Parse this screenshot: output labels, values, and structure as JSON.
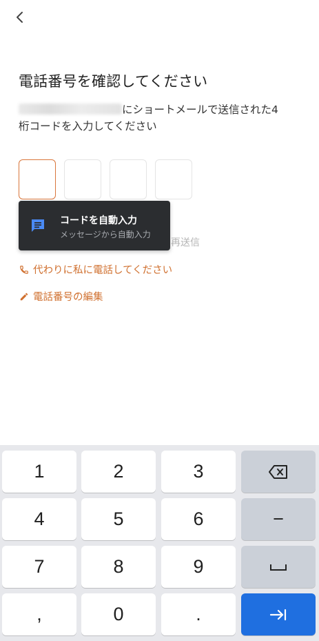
{
  "header": {
    "back_icon": "chevron-left-icon"
  },
  "title": "電話番号を確認してください",
  "description": {
    "after_number": "にショートメールで送信された4",
    "line2": "桁コードを入力してください"
  },
  "code_inputs": [
    "",
    "",
    "",
    ""
  ],
  "resend_text": "再送信",
  "autofill_popup": {
    "title": "コードを自動入力",
    "subtitle": "メッセージから自動入力",
    "icon": "message-icon",
    "icon_color": "#4a8af4"
  },
  "links": {
    "call_me": "代わりに私に電話してください",
    "edit_number": "電話番号の編集",
    "color": "#d0702f"
  },
  "keyboard": {
    "rows": [
      [
        "1",
        "2",
        "3",
        "backspace"
      ],
      [
        "4",
        "5",
        "6",
        "−"
      ],
      [
        "7",
        "8",
        "9",
        "space"
      ],
      [
        ",",
        "0",
        ".",
        "next"
      ]
    ],
    "accent": "#1f6fe0"
  }
}
